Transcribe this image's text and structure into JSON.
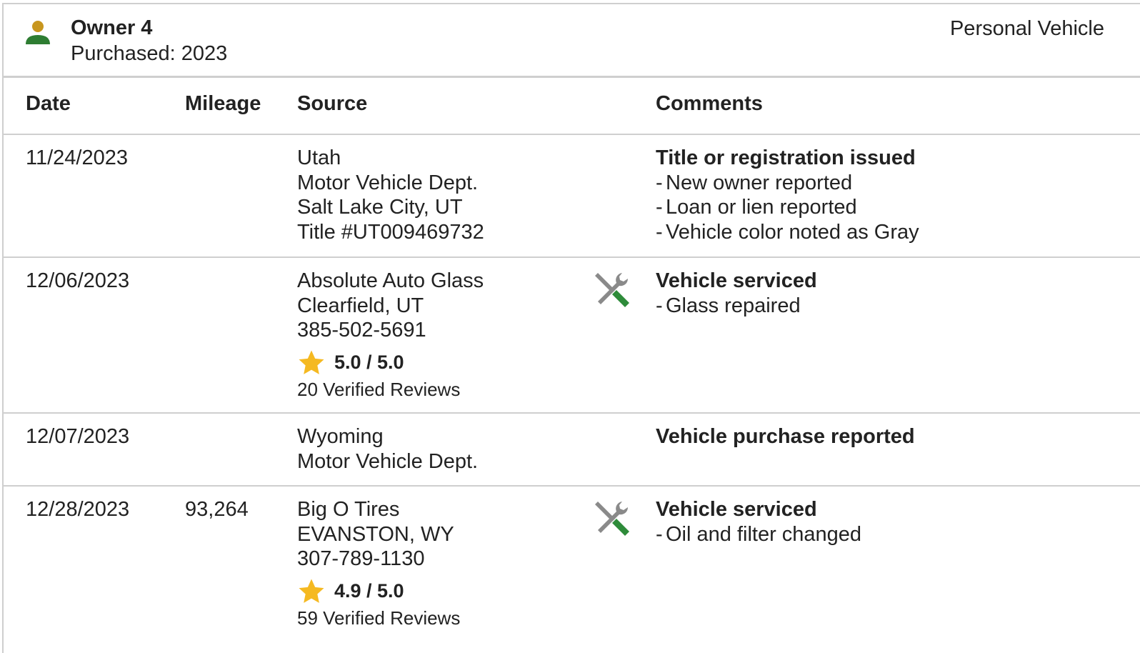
{
  "owner": {
    "title": "Owner 4",
    "purchased": "Purchased: 2023",
    "vehicle_type": "Personal Vehicle",
    "icon": "person-icon"
  },
  "table": {
    "headers": {
      "date": "Date",
      "mileage": "Mileage",
      "source": "Source",
      "comments": "Comments"
    },
    "rows": [
      {
        "date": "11/24/2023",
        "mileage": "",
        "source": [
          "Utah",
          "Motor Vehicle Dept.",
          "Salt Lake City, UT",
          "Title #UT009469732"
        ],
        "comment_title": "Title or registration issued",
        "comment_items": [
          "New owner reported",
          "Loan or lien reported",
          "Vehicle color noted as Gray"
        ]
      },
      {
        "date": "12/06/2023",
        "mileage": "",
        "source": [
          "Absolute Auto Glass",
          "Clearfield, UT",
          "385-502-5691"
        ],
        "rating": "5.0 / 5.0",
        "reviews": "20 Verified Reviews",
        "icon": "service-wrench-icon",
        "comment_title": "Vehicle serviced",
        "comment_items": [
          "Glass repaired"
        ]
      },
      {
        "date": "12/07/2023",
        "mileage": "",
        "source": [
          "Wyoming",
          "Motor Vehicle Dept."
        ],
        "comment_title": "Vehicle purchase reported",
        "comment_items": []
      },
      {
        "date": "12/28/2023",
        "mileage": "93,264",
        "source": [
          "Big O Tires",
          "EVANSTON, WY",
          "307-789-1130"
        ],
        "rating": "4.9 / 5.0",
        "reviews": "59 Verified Reviews",
        "icon": "service-wrench-icon",
        "comment_title": "Vehicle serviced",
        "comment_items": [
          "Oil and filter changed"
        ]
      }
    ]
  },
  "colors": {
    "person_head": "#c8961e",
    "person_body": "#2e7d32",
    "star": "#f5b921",
    "tool_gray": "#8a8a8a",
    "tool_green": "#2e8b3a",
    "divider": "#cfcfcf"
  }
}
